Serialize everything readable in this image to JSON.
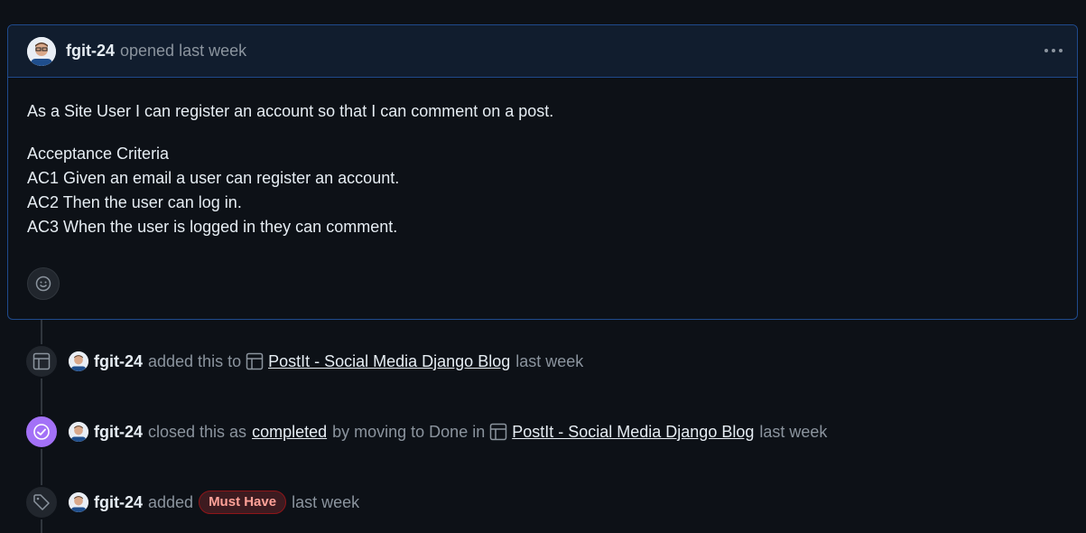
{
  "comment": {
    "author": "fgit-24",
    "meta": "opened last week",
    "body": [
      "As a Site User I can register an account so that I can comment on a post."
    ],
    "criteria": [
      "Acceptance Criteria",
      "AC1 Given an email a user can register an account.",
      "AC2 Then the user can log in.",
      "AC3 When the user is logged in they can comment."
    ]
  },
  "events": {
    "added_project": {
      "author": "fgit-24",
      "action": "added this to",
      "project": "PostIt - Social Media Django Blog",
      "time": "last week"
    },
    "closed": {
      "author": "fgit-24",
      "action": "closed this as",
      "state": "completed",
      "middle": "by moving to Done in",
      "project": "PostIt - Social Media Django Blog",
      "time": "last week"
    },
    "labeled": {
      "author": "fgit-24",
      "action": "added",
      "label": "Must Have",
      "time": "last week"
    }
  },
  "colors": {
    "accent_border": "#1f4a8c",
    "closed_badge": "#a371f7",
    "label_text": "#ffa198"
  }
}
